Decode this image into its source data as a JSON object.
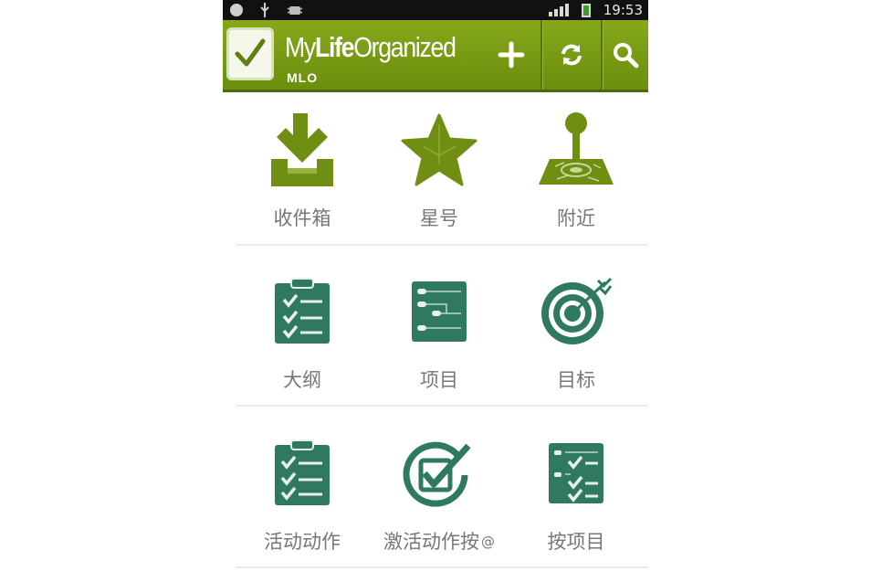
{
  "status_bar": {
    "time": "19:53"
  },
  "action_bar": {
    "title_prefix": "My",
    "title_bold": "Life",
    "title_suffix": "Organized",
    "subtitle": "MLO",
    "add_icon": "plus-icon",
    "sync_icon": "sync-icon",
    "search_icon": "search-icon"
  },
  "colors": {
    "action_bar": "#7a9b14",
    "row1_icon": "#6f8e12",
    "row_icon": "#2f7a5e",
    "label": "#777777"
  },
  "rows": [
    {
      "items": [
        {
          "label": "收件箱",
          "icon": "inbox-download-icon"
        },
        {
          "label": "星号",
          "icon": "star-icon"
        },
        {
          "label": "附近",
          "icon": "location-pin-icon"
        }
      ]
    },
    {
      "items": [
        {
          "label": "大纲",
          "icon": "outline-clipboard-icon"
        },
        {
          "label": "项目",
          "icon": "projects-board-icon"
        },
        {
          "label": "目标",
          "icon": "target-icon"
        }
      ]
    },
    {
      "items": [
        {
          "label": "活动动作",
          "icon": "active-actions-clipboard-icon"
        },
        {
          "label": "激活动作按",
          "icon": "check-circle-icon"
        },
        {
          "label": "按项目",
          "icon": "by-project-checklist-icon"
        }
      ]
    }
  ]
}
